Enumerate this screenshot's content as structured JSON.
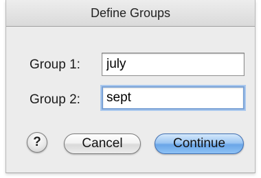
{
  "dialog": {
    "title": "Define Groups"
  },
  "group1": {
    "label": "Group 1:",
    "value": "july"
  },
  "group2": {
    "label": "Group 2:",
    "value": "sept"
  },
  "buttons": {
    "help_glyph": "?",
    "cancel_label": "Cancel",
    "continue_label": "Continue"
  },
  "colors": {
    "accent": "#6aa6e8",
    "focus_ring": "#7aa2d6"
  },
  "icons": {
    "help": "help-icon"
  }
}
